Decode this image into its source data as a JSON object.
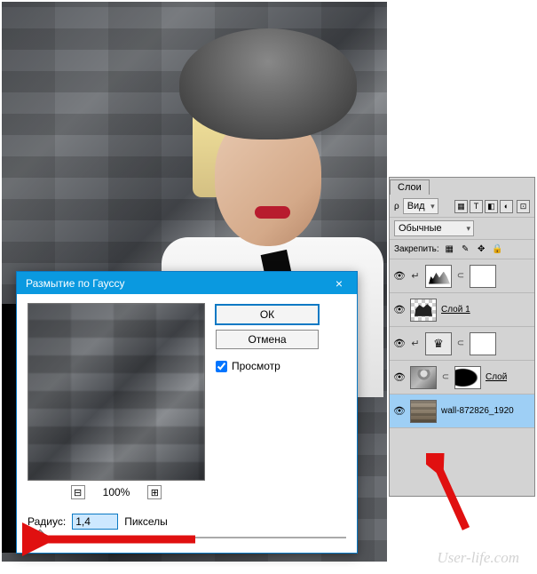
{
  "dialog": {
    "title": "Размытие по Гауссу",
    "close_glyph": "×",
    "ok_label": "ОК",
    "cancel_label": "Отмена",
    "preview_checkbox_label": "Просмотр",
    "preview_checked": true,
    "zoom_minus": "⊟",
    "zoom_percent": "100%",
    "zoom_plus": "⊞",
    "radius_label": "Радиус:",
    "radius_value": "1,4",
    "radius_unit": "Пикселы"
  },
  "layers_panel": {
    "tab_label": "Слои",
    "kind_label": "Вид",
    "filter_icons": [
      "▦",
      "T",
      "◧",
      "◐"
    ],
    "toggle_icon": "⊡",
    "blend_mode": "Обычные",
    "lock_label": "Закрепить:",
    "lock_icons": [
      "▦",
      "✎",
      "✥",
      "🔒"
    ],
    "layers": [
      {
        "eye": "👁",
        "adj": "↵",
        "thumb1": "levels",
        "link": "⊂",
        "thumb2": "mask-white",
        "name": ""
      },
      {
        "eye": "👁",
        "adj": "",
        "thumb1": "checker",
        "link": "",
        "thumb2": "",
        "name": "Слой 1",
        "underline": true
      },
      {
        "eye": "👁",
        "adj": "↵",
        "thumb1": "crown",
        "crown_glyph": "♛",
        "link": "⊂",
        "thumb2": "mask-white",
        "name": ""
      },
      {
        "eye": "👁",
        "adj": "",
        "thumb1": "photo",
        "link": "⊂",
        "thumb2": "mask-black",
        "name": "Слой",
        "underline": true
      },
      {
        "eye": "👁",
        "adj": "",
        "thumb1": "wall",
        "link": "",
        "thumb2": "",
        "name": "wall-872826_1920",
        "selected": true
      }
    ]
  },
  "watermark": "User-life.com"
}
